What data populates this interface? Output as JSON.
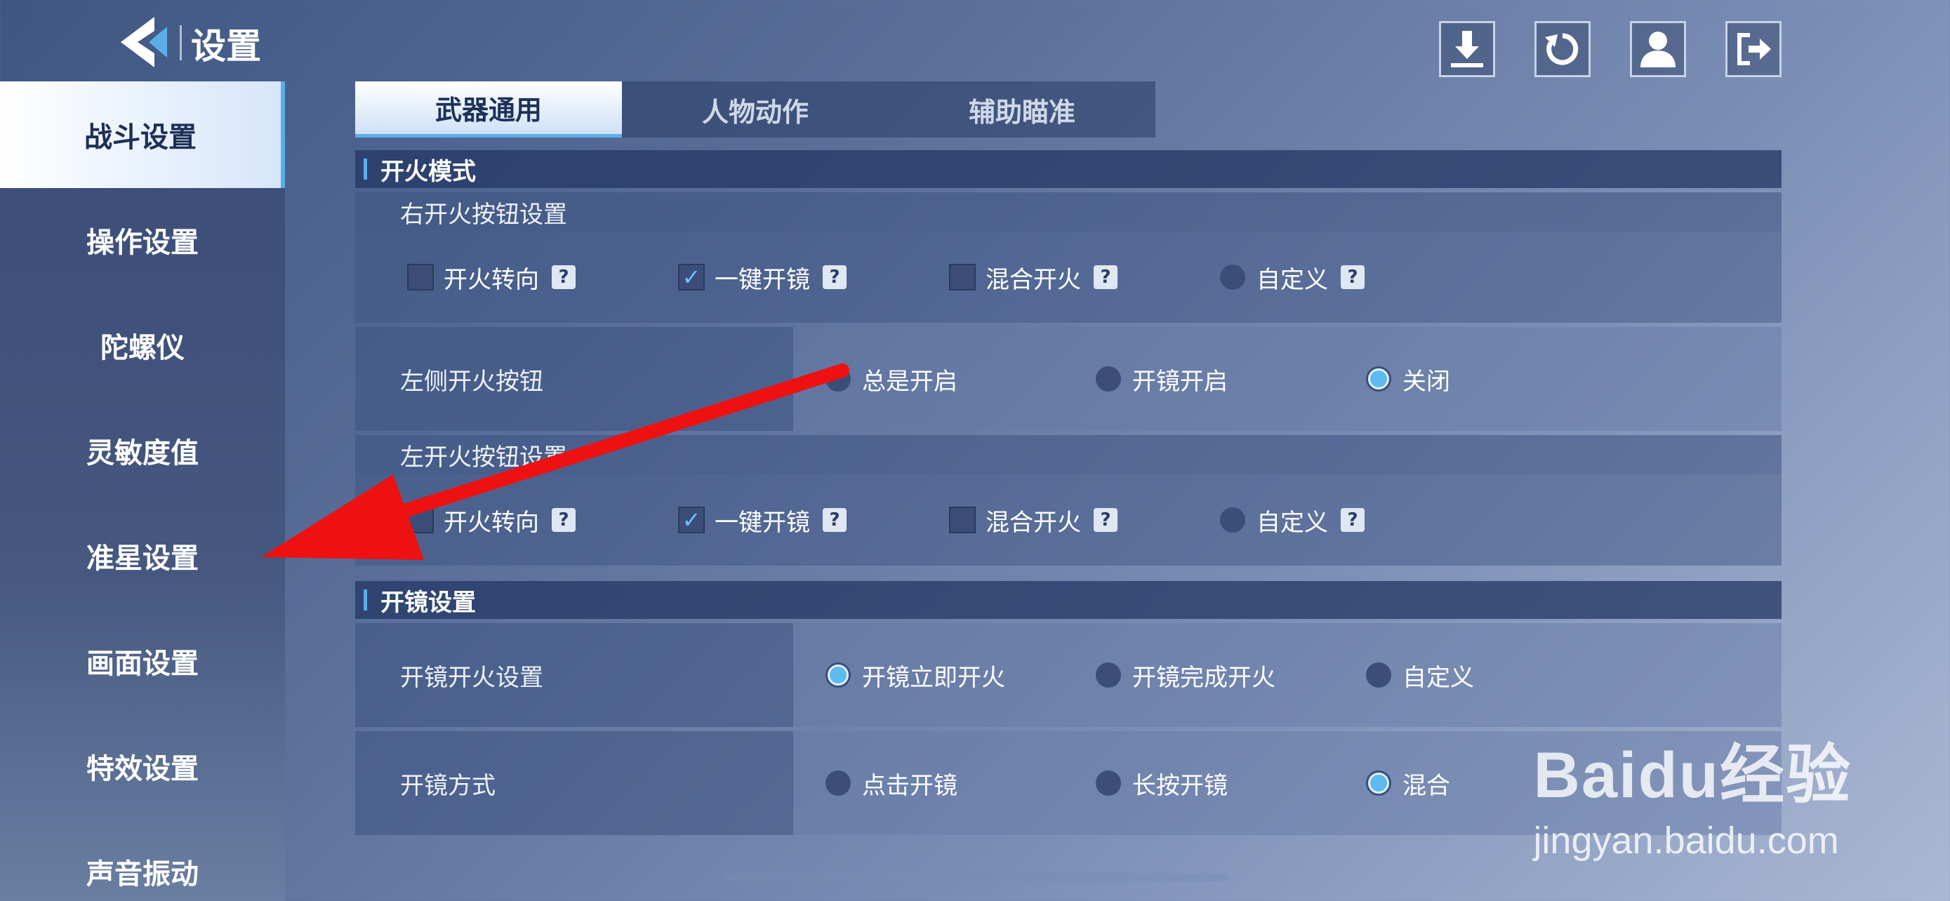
{
  "header": {
    "title": "设置"
  },
  "sidebar": {
    "items": [
      {
        "label": "战斗设置"
      },
      {
        "label": "操作设置"
      },
      {
        "label": "陀螺仪"
      },
      {
        "label": "灵敏度值"
      },
      {
        "label": "准星设置"
      },
      {
        "label": "画面设置"
      },
      {
        "label": "特效设置"
      },
      {
        "label": "声音振动"
      }
    ],
    "active_index": 0
  },
  "tabs": [
    {
      "label": "武器通用"
    },
    {
      "label": "人物动作"
    },
    {
      "label": "辅助瞄准"
    }
  ],
  "fire_mode": {
    "title": "开火模式",
    "right_fire_button": {
      "label": "右开火按钮设置",
      "options": [
        {
          "label": "开火转向",
          "type": "checkbox",
          "checked": false
        },
        {
          "label": "一键开镜",
          "type": "checkbox",
          "checked": true
        },
        {
          "label": "混合开火",
          "type": "checkbox",
          "checked": false
        },
        {
          "label": "自定义",
          "type": "radio",
          "checked": false
        }
      ]
    },
    "left_side_fire_button": {
      "label": "左侧开火按钮",
      "options": [
        {
          "label": "总是开启",
          "checked": false
        },
        {
          "label": "开镜开启",
          "checked": false
        },
        {
          "label": "关闭",
          "checked": true
        }
      ]
    },
    "left_fire_button": {
      "label": "左开火按钮设置",
      "options": [
        {
          "label": "开火转向",
          "type": "checkbox",
          "checked": false
        },
        {
          "label": "一键开镜",
          "type": "checkbox",
          "checked": true
        },
        {
          "label": "混合开火",
          "type": "checkbox",
          "checked": false
        },
        {
          "label": "自定义",
          "type": "radio",
          "checked": false
        }
      ]
    }
  },
  "scope": {
    "title": "开镜设置",
    "scope_fire": {
      "label": "开镜开火设置",
      "options": [
        {
          "label": "开镜立即开火",
          "checked": true
        },
        {
          "label": "开镜完成开火",
          "checked": false
        },
        {
          "label": "自定义",
          "checked": false
        }
      ]
    },
    "scope_mode": {
      "label": "开镜方式",
      "options": [
        {
          "label": "点击开镜",
          "checked": false
        },
        {
          "label": "长按开镜",
          "checked": false
        },
        {
          "label": "混合",
          "checked": true
        }
      ]
    }
  },
  "help_glyph": "?",
  "watermark": {
    "logo": "Baidu经验",
    "url": "jingyan.baidu.com"
  },
  "colors": {
    "accent": "#5aaee8",
    "arrow": "#ee1111"
  }
}
